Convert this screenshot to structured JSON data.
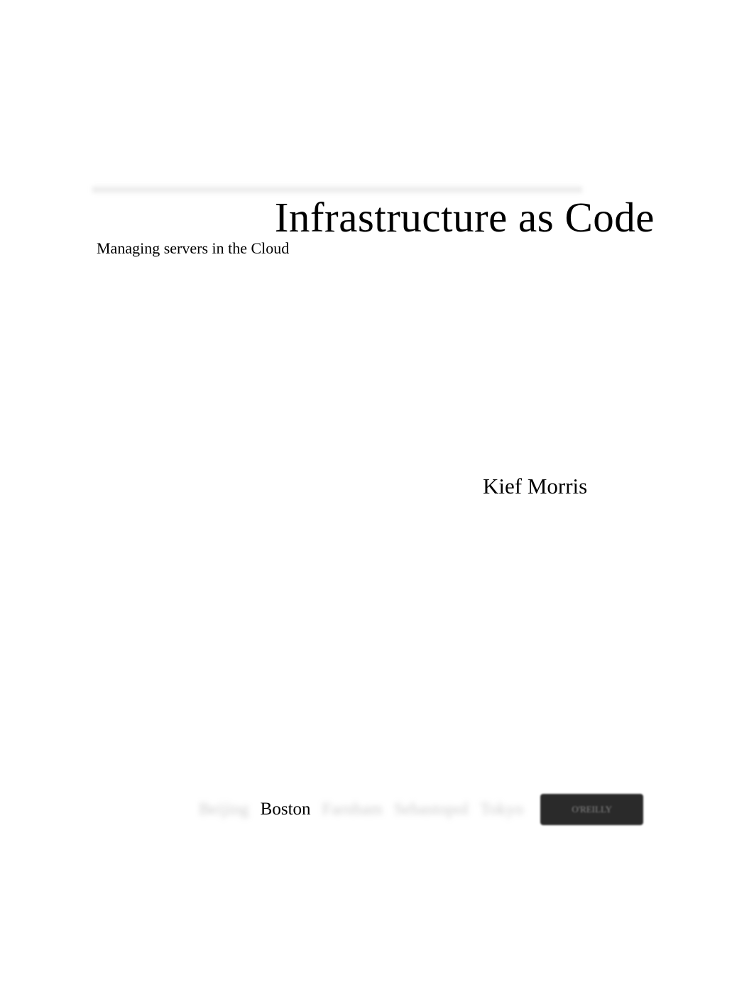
{
  "title": "Infrastructure as Code",
  "subtitle": "Managing servers in the Cloud",
  "author": "Kief Morris",
  "publisher": {
    "cities_blurred_1": "Beijing",
    "city_clear": "Boston",
    "cities_blurred_2": "Farnham",
    "cities_blurred_3": "Sebastopol",
    "cities_blurred_4": "Tokyo",
    "box_text": "O'REILLY"
  }
}
